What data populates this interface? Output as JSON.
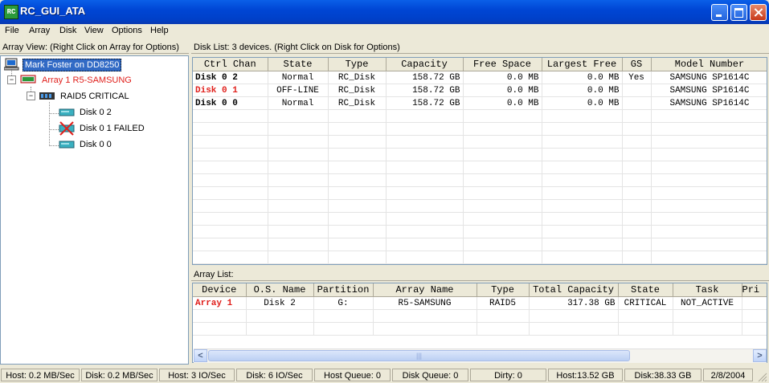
{
  "window": {
    "title": "RC_GUI_ATA",
    "icon_text": "RC"
  },
  "menu": [
    "File",
    "Array",
    "Disk",
    "View",
    "Options",
    "Help"
  ],
  "tree_pane": {
    "header": "Array View:  (Right Click on Array for Options)",
    "host": "Mark Foster on DD8250",
    "array": "Array 1  R5-SAMSUNG",
    "raid": "RAID5 CRITICAL",
    "disks": [
      "Disk  0 2",
      "Disk  0 1  FAILED",
      "Disk  0 0"
    ],
    "expander_minus": "−"
  },
  "disk_list": {
    "header": "Disk List: 3 devices.  (Right Click on Disk for Options)",
    "columns": [
      "Ctrl Chan",
      "State",
      "Type",
      "Capacity",
      "Free Space",
      "Largest Free",
      "GS",
      "Model Number"
    ],
    "rows": [
      {
        "ctrl": "Disk  0 2",
        "state": "Normal",
        "type": "RC_Disk",
        "capacity": "158.72 GB",
        "free": "0.0 MB",
        "largest": "0.0 MB",
        "gs": "Yes",
        "model": "SAMSUNG SP1614C",
        "failed": false
      },
      {
        "ctrl": "Disk  0 1",
        "state": "OFF-LINE",
        "type": "RC_Disk",
        "capacity": "158.72 GB",
        "free": "0.0 MB",
        "largest": "0.0 MB",
        "gs": "",
        "model": "SAMSUNG SP1614C",
        "failed": true
      },
      {
        "ctrl": "Disk  0 0",
        "state": "Normal",
        "type": "RC_Disk",
        "capacity": "158.72 GB",
        "free": "0.0 MB",
        "largest": "0.0 MB",
        "gs": "",
        "model": "SAMSUNG SP1614C",
        "failed": false
      }
    ]
  },
  "array_list": {
    "header": "Array List:",
    "columns": [
      "Device",
      "O.S. Name",
      "Partition",
      "Array Name",
      "Type",
      "Total Capacity",
      "State",
      "Task",
      "Pri"
    ],
    "rows": [
      {
        "device": "Array 1",
        "os_name": "Disk 2",
        "partition": "G:",
        "array_name": "R5-SAMSUNG",
        "type": "RAID5",
        "total": "317.38 GB",
        "state": "CRITICAL",
        "task": "NOT_ACTIVE",
        "pri": ""
      }
    ],
    "scroll_left": "<",
    "scroll_right": ">",
    "scroll_grip": "|||"
  },
  "status_bar": [
    "Host: 0.2 MB/Sec",
    "Disk: 0.2 MB/Sec",
    "Host: 3 IO/Sec",
    "Disk: 6 IO/Sec",
    "Host Queue: 0",
    "Disk Queue: 0",
    "Dirty: 0",
    "Host:13.52 GB",
    "Disk:38.33 GB",
    "2/8/2004"
  ],
  "colors": {
    "failed": "#e0201c",
    "selection": "#316ac5",
    "titlebar": "#0046d5"
  }
}
